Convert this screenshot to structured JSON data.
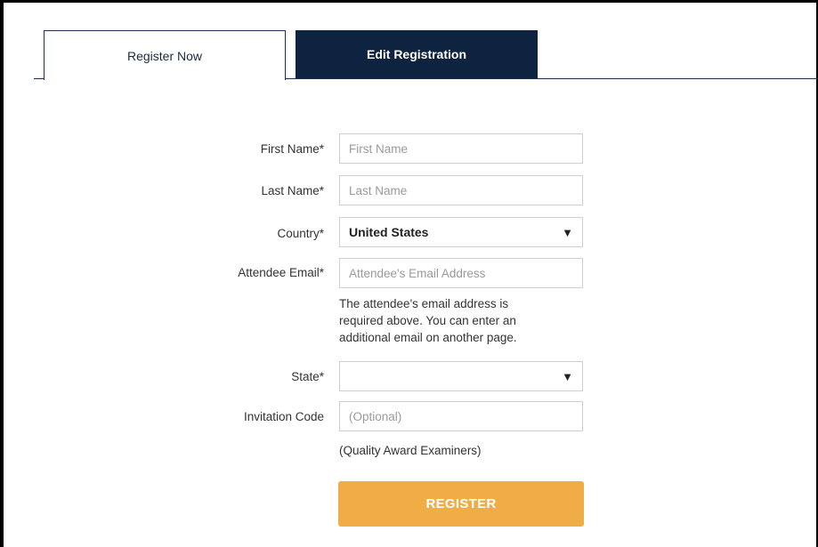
{
  "tabs": [
    {
      "label": "Register Now",
      "active": true
    },
    {
      "label": "Edit Registration",
      "active": false
    }
  ],
  "form": {
    "first_name": {
      "label": "First Name*",
      "placeholder": "First Name",
      "value": ""
    },
    "last_name": {
      "label": "Last Name*",
      "placeholder": "Last Name",
      "value": ""
    },
    "country": {
      "label": "Country*",
      "value": "United States"
    },
    "email": {
      "label": "Attendee Email*",
      "placeholder": "Attendee's Email Address",
      "value": "",
      "help_lines": [
        "The attendee's email address is",
        "required above. You can enter an",
        "additional email on another page."
      ]
    },
    "state": {
      "label": "State*",
      "value": ""
    },
    "invitation_code": {
      "label": "Invitation Code",
      "placeholder": "(Optional)",
      "value": "",
      "note": "(Quality Award Examiners)"
    },
    "submit_label": "REGISTER"
  },
  "colors": {
    "tab_dark": "#0d2340",
    "button": "#f0ad45"
  },
  "icons": {
    "select_caret": "▼"
  }
}
